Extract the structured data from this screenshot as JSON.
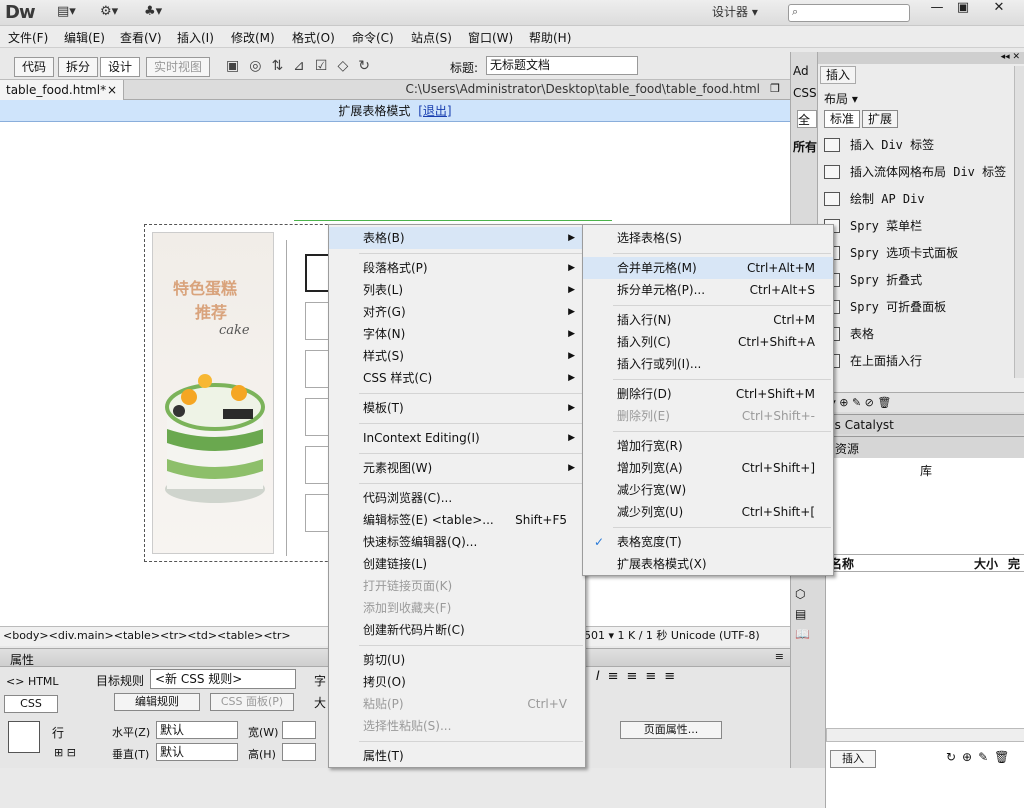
{
  "app": {
    "logo": "Dw",
    "layout": "设计器 ▾",
    "win_min": "—",
    "win_max": "▣",
    "win_close": "✕"
  },
  "menubar": [
    "文件(F)",
    "编辑(E)",
    "查看(V)",
    "插入(I)",
    "修改(M)",
    "格式(O)",
    "命令(C)",
    "站点(S)",
    "窗口(W)",
    "帮助(H)"
  ],
  "doc_toolbar": {
    "code": "代码",
    "split": "拆分",
    "design": "设计",
    "live": "实时视图",
    "title_label": "标题:",
    "title_value": "无标题文档"
  },
  "tab": {
    "name": "table_food.html*",
    "close": "×",
    "path": "C:\\Users\\Administrator\\Desktop\\table_food\\table_food.html"
  },
  "expanded_bar": {
    "text": "扩展表格模式",
    "exit": "[退出]"
  },
  "cake": {
    "title1": "特色蛋糕",
    "title2": "推荐",
    "sub": "cake"
  },
  "status": {
    "tags": "<body><div.main><table><tr><td><table><tr>",
    "right": "501 ▾ 1 K / 1 秒 Unicode (UTF-8)"
  },
  "properties": {
    "header": "属性",
    "html": "HTML",
    "css": "CSS",
    "target_rule_label": "目标规则",
    "target_rule_value": "<新 CSS 规则>",
    "edit_rule": "编辑规则",
    "css_panel": "CSS 面板(P)",
    "font_prefix": "字",
    "size_prefix": "大",
    "row_label": "行",
    "horz_label": "水平(Z)",
    "horz_value": "默认",
    "vert_label": "垂直(T)",
    "vert_value": "默认",
    "width_label": "宽(W)",
    "height_label": "高(H)",
    "page_props": "页面属性..."
  },
  "right_panel": {
    "tab_ad": "Ad",
    "tab_css": "CSS",
    "tab_all": "全",
    "tab_all2": "所有",
    "insert_tab": "插入",
    "layout_sel": "布局 ▾",
    "std": "标准",
    "ext": "扩展",
    "items": [
      "插入 Div 标签",
      "插入流体网格布局 Div 标签",
      "绘制 AP Div",
      "Spry 菜单栏",
      "Spry 选项卡式面板",
      "Spry 折叠式",
      "Spry 可折叠面板",
      "表格",
      "在上面插入行"
    ],
    "bc_tab": "ess Catalyst",
    "assets": "资源",
    "lib": "库",
    "col_name": "名称",
    "col_size": "大小",
    "col_full": "完",
    "insert_btn": "插入"
  },
  "context_menu": [
    {
      "label": "表格(B)",
      "arrow": "▶",
      "hl": true
    },
    {
      "sep": true
    },
    {
      "label": "段落格式(P)",
      "arrow": "▶"
    },
    {
      "label": "列表(L)",
      "arrow": "▶"
    },
    {
      "label": "对齐(G)",
      "arrow": "▶"
    },
    {
      "label": "字体(N)",
      "arrow": "▶"
    },
    {
      "label": "样式(S)",
      "arrow": "▶"
    },
    {
      "label": "CSS 样式(C)",
      "arrow": "▶"
    },
    {
      "sep": true
    },
    {
      "label": "模板(T)",
      "arrow": "▶"
    },
    {
      "sep": true
    },
    {
      "label": "InContext Editing(I)",
      "arrow": "▶"
    },
    {
      "sep": true
    },
    {
      "label": "元素视图(W)",
      "arrow": "▶"
    },
    {
      "sep": true
    },
    {
      "label": "代码浏览器(C)..."
    },
    {
      "label": "编辑标签(E) <table>...",
      "shortcut": "Shift+F5"
    },
    {
      "label": "快速标签编辑器(Q)..."
    },
    {
      "label": "创建链接(L)"
    },
    {
      "label": "打开链接页面(K)",
      "dis": true
    },
    {
      "label": "添加到收藏夹(F)",
      "dis": true
    },
    {
      "label": "创建新代码片断(C)"
    },
    {
      "sep": true
    },
    {
      "label": "剪切(U)"
    },
    {
      "label": "拷贝(O)"
    },
    {
      "label": "粘贴(P)",
      "shortcut": "Ctrl+V",
      "dis": true
    },
    {
      "label": "选择性粘贴(S)...",
      "dis": true
    },
    {
      "sep": true
    },
    {
      "label": "属性(T)"
    }
  ],
  "submenu": [
    {
      "label": "选择表格(S)"
    },
    {
      "sep": true
    },
    {
      "label": "合并单元格(M)",
      "shortcut": "Ctrl+Alt+M",
      "hl": true
    },
    {
      "label": "拆分单元格(P)...",
      "shortcut": "Ctrl+Alt+S"
    },
    {
      "sep": true
    },
    {
      "label": "插入行(N)",
      "shortcut": "Ctrl+M"
    },
    {
      "label": "插入列(C)",
      "shortcut": "Ctrl+Shift+A"
    },
    {
      "label": "插入行或列(I)..."
    },
    {
      "sep": true
    },
    {
      "label": "删除行(D)",
      "shortcut": "Ctrl+Shift+M"
    },
    {
      "label": "删除列(E)",
      "shortcut": "Ctrl+Shift+-",
      "dis": true
    },
    {
      "sep": true
    },
    {
      "label": "增加行宽(R)"
    },
    {
      "label": "增加列宽(A)",
      "shortcut": "Ctrl+Shift+]"
    },
    {
      "label": "减少行宽(W)"
    },
    {
      "label": "减少列宽(U)",
      "shortcut": "Ctrl+Shift+["
    },
    {
      "sep": true
    },
    {
      "label": "表格宽度(T)",
      "check": "✓"
    },
    {
      "label": "扩展表格模式(X)"
    }
  ],
  "colors": {
    "highlight": "#d8e6f6",
    "expbar": "#cfe4fb",
    "cake_title": "#d9a37c",
    "check": "#2a7ad8"
  }
}
